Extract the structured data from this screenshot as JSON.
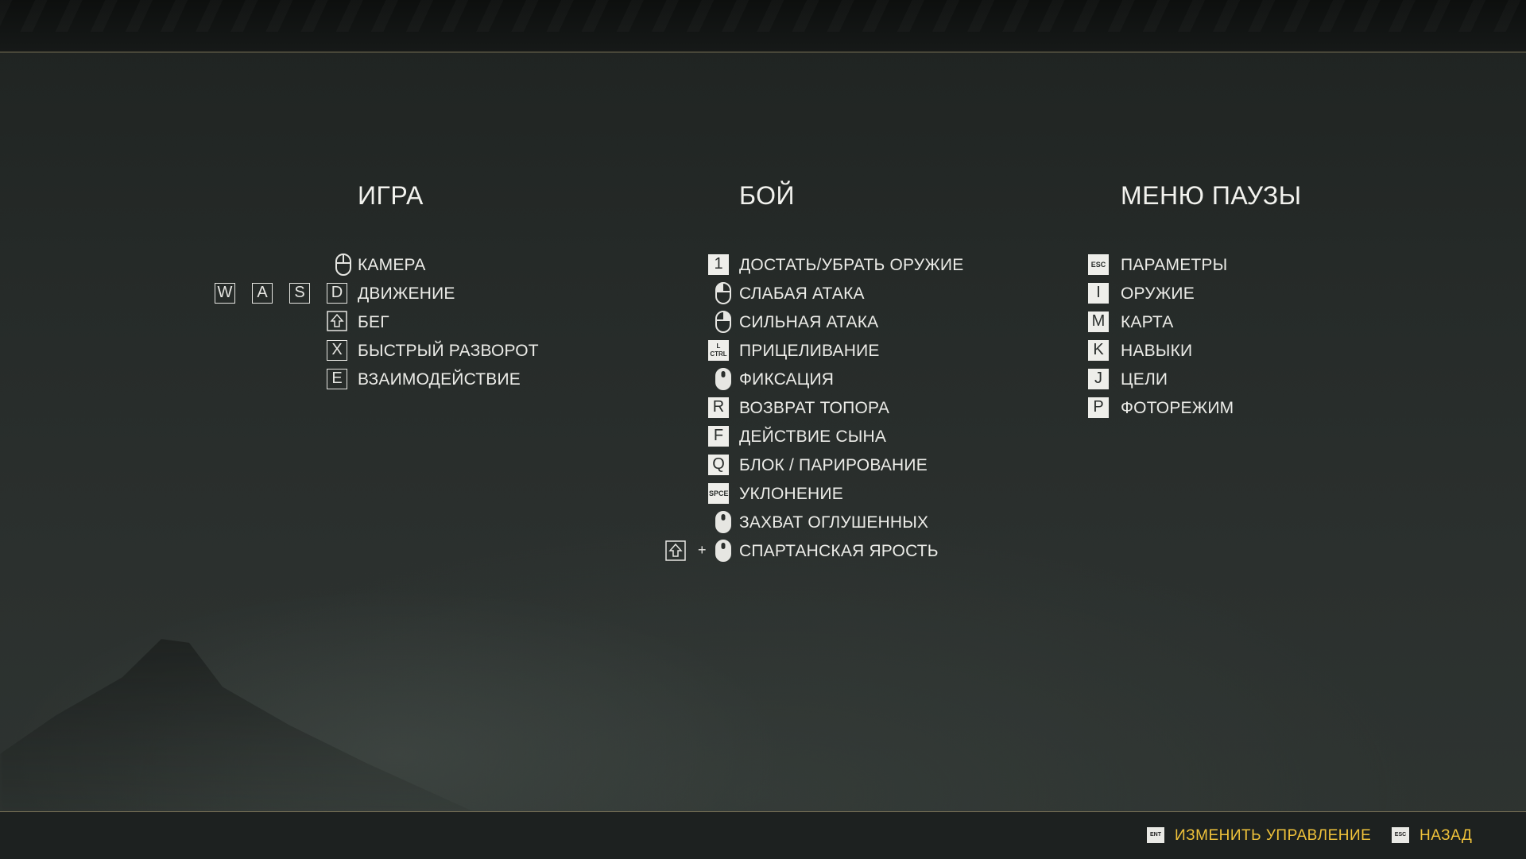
{
  "columns": {
    "game": {
      "title": "ИГРА",
      "rows": [
        {
          "keys": [
            "mouse-icon"
          ],
          "label": "КАМЕРА"
        },
        {
          "keys": [
            "W",
            "A",
            "S",
            "D"
          ],
          "label": "ДВИЖЕНИЕ"
        },
        {
          "keys": [
            "shift-icon"
          ],
          "label": "БЕГ"
        },
        {
          "keys": [
            "X"
          ],
          "label": "БЫСТРЫЙ РАЗВОРОТ"
        },
        {
          "keys": [
            "E"
          ],
          "label": "ВЗАИМОДЕЙСТВИЕ"
        }
      ]
    },
    "combat": {
      "title": "БОЙ",
      "rows": [
        {
          "keys": [
            "1"
          ],
          "label": "ДОСТАТЬ/УБРАТЬ ОРУЖИЕ"
        },
        {
          "keys": [
            "mouse-left-icon"
          ],
          "label": "СЛАБАЯ АТАКА"
        },
        {
          "keys": [
            "mouse-right-icon"
          ],
          "label": "СИЛЬНАЯ АТАКА"
        },
        {
          "keys": [
            "L CTRL"
          ],
          "label": "ПРИЦЕЛИВАНИЕ"
        },
        {
          "keys": [
            "mouse-middle-icon"
          ],
          "label": "ФИКСАЦИЯ"
        },
        {
          "keys": [
            "R"
          ],
          "label": "ВОЗВРАТ ТОПОРА"
        },
        {
          "keys": [
            "F"
          ],
          "label": "ДЕЙСТВИЕ СЫНА"
        },
        {
          "keys": [
            "Q"
          ],
          "label": "БЛОК / ПАРИРОВАНИЕ"
        },
        {
          "keys": [
            "SPCE"
          ],
          "label": "УКЛОНЕНИЕ"
        },
        {
          "keys": [
            "mouse-middle-icon"
          ],
          "label": "ЗАХВАТ ОГЛУШЕННЫХ"
        },
        {
          "keys": [
            "shift-icon",
            "+",
            "mouse-middle-icon"
          ],
          "label": "СПАРТАНСКАЯ ЯРОСТЬ"
        }
      ]
    },
    "pause": {
      "title": "МЕНЮ ПАУЗЫ",
      "rows": [
        {
          "keys": [
            "ESC"
          ],
          "label": "ПАРАМЕТРЫ"
        },
        {
          "keys": [
            "I"
          ],
          "label": "ОРУЖИЕ"
        },
        {
          "keys": [
            "M"
          ],
          "label": "КАРТА"
        },
        {
          "keys": [
            "K"
          ],
          "label": "НАВЫКИ"
        },
        {
          "keys": [
            "J"
          ],
          "label": "ЦЕЛИ"
        },
        {
          "keys": [
            "P"
          ],
          "label": "ФОТОРЕЖИМ"
        }
      ]
    }
  },
  "footer": {
    "change_controls": {
      "key": "ENT",
      "label": "ИЗМЕНИТЬ УПРАВЛЕНИЕ"
    },
    "back": {
      "key": "ESC",
      "label": "НАЗАД"
    }
  },
  "colors": {
    "accent": "#f0c23a",
    "text": "#ecece8",
    "divider": "#7c7458"
  }
}
